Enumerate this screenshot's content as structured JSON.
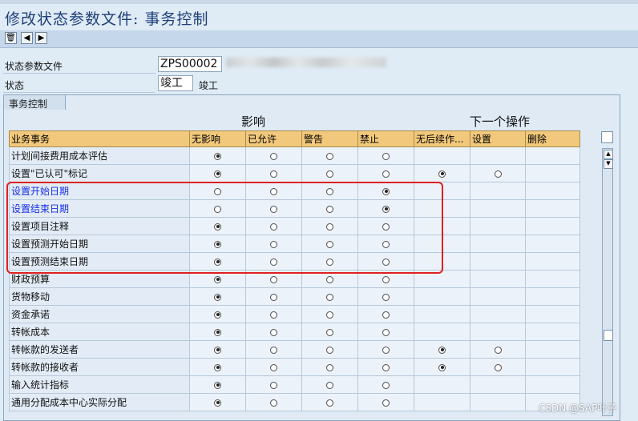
{
  "title": "修改状态参数文件: 事务控制",
  "toolbar": {
    "buttons": [
      "trash-icon",
      "prev-icon",
      "next-icon"
    ]
  },
  "fields": {
    "profile_label": "状态参数文件",
    "profile_value": "ZPS00002",
    "status_label": "状态",
    "status_value": "竣工",
    "status_text": "竣工"
  },
  "group": {
    "tab_label": "事务控制",
    "influence_header": "影响",
    "next_action_header": "下一个操作"
  },
  "table": {
    "columns": [
      "业务事务",
      "无影响",
      "已允许",
      "警告",
      "禁止",
      "无后续作...",
      "设置",
      "删除"
    ],
    "rows": [
      {
        "label": "计划间接费用成本评估",
        "selected": 0,
        "next": []
      },
      {
        "label": "设置\"已认可\"标记",
        "selected": 0,
        "next": [
          0,
          0
        ]
      },
      {
        "label": "设置开始日期",
        "selected": 3,
        "next": [],
        "highlight": true
      },
      {
        "label": "设置结束日期",
        "selected": 3,
        "next": [],
        "highlight": true
      },
      {
        "label": "设置项目注释",
        "selected": 0,
        "next": []
      },
      {
        "label": "设置预测开始日期",
        "selected": 0,
        "next": []
      },
      {
        "label": "设置预测结束日期",
        "selected": 0,
        "next": []
      },
      {
        "label": "财政预算",
        "selected": 0,
        "next": []
      },
      {
        "label": "货物移动",
        "selected": 0,
        "next": []
      },
      {
        "label": "资金承诺",
        "selected": 0,
        "next": []
      },
      {
        "label": "转帐成本",
        "selected": 0,
        "next": []
      },
      {
        "label": "转帐款的发送者",
        "selected": 0,
        "next": [
          0,
          0
        ]
      },
      {
        "label": "转帐款的接收者",
        "selected": 0,
        "next": [
          0,
          0
        ]
      },
      {
        "label": "输入统计指标",
        "selected": 0,
        "next": []
      },
      {
        "label": "通用分配成本中心实际分配",
        "selected": 0,
        "next": []
      }
    ]
  },
  "watermark": "CSDN @SAP叶子",
  "colors": {
    "header_bg": "#f2c97c",
    "highlight_text": "#1a2ee6",
    "annotation_box": "#e02020"
  }
}
